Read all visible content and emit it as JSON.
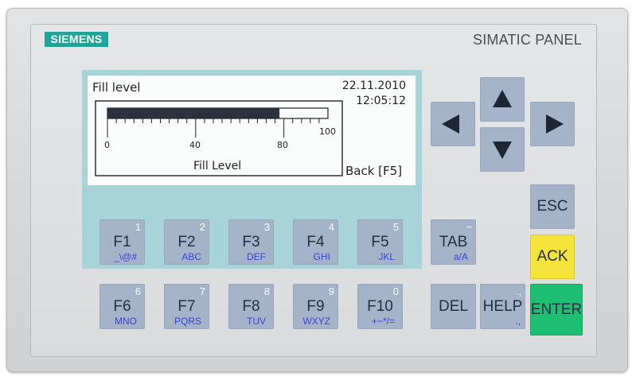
{
  "brand": {
    "logo": "SIEMENS",
    "model": "SIMATIC PANEL"
  },
  "screen": {
    "title": "Fill level",
    "date": "22.11.2010",
    "time": "12:05:12",
    "bar_label": "Fill Level",
    "back_label": "Back [F5]",
    "scale_labels": [
      "0",
      "40",
      "80",
      "100"
    ],
    "fill_percent": 78
  },
  "function_keys": [
    {
      "label": "F1",
      "num": "1",
      "sub": "_\\@#"
    },
    {
      "label": "F2",
      "num": "2",
      "sub": "ABC"
    },
    {
      "label": "F3",
      "num": "3",
      "sub": "DEF"
    },
    {
      "label": "F4",
      "num": "4",
      "sub": "GHI"
    },
    {
      "label": "F5",
      "num": "5",
      "sub": "JKL"
    },
    {
      "label": "F6",
      "num": "6",
      "sub": "MNO"
    },
    {
      "label": "F7",
      "num": "7",
      "sub": "PQRS"
    },
    {
      "label": "F8",
      "num": "8",
      "sub": "TUV"
    },
    {
      "label": "F9",
      "num": "9",
      "sub": "WXYZ"
    },
    {
      "label": "F10",
      "num": "0",
      "sub": "+−*/="
    }
  ],
  "control_keys": {
    "tab": {
      "label": "TAB",
      "num": "−",
      "sub": "a/A"
    },
    "del": {
      "label": "DEL"
    },
    "help": {
      "label": "HELP",
      "num": ".,",
      "sub": ".,"
    },
    "esc": {
      "label": "ESC"
    },
    "ack": {
      "label": "ACK"
    },
    "enter": {
      "label": "ENTER"
    }
  },
  "colors": {
    "logo": "#22a39a",
    "key": "#a5b3c9",
    "ack": "#f3e33a",
    "enter": "#1fbf73",
    "lcd_bg": "#a6d4d9"
  },
  "icons": {
    "up": "arrow-up-icon",
    "down": "arrow-down-icon",
    "left": "arrow-left-icon",
    "right": "arrow-right-icon"
  }
}
